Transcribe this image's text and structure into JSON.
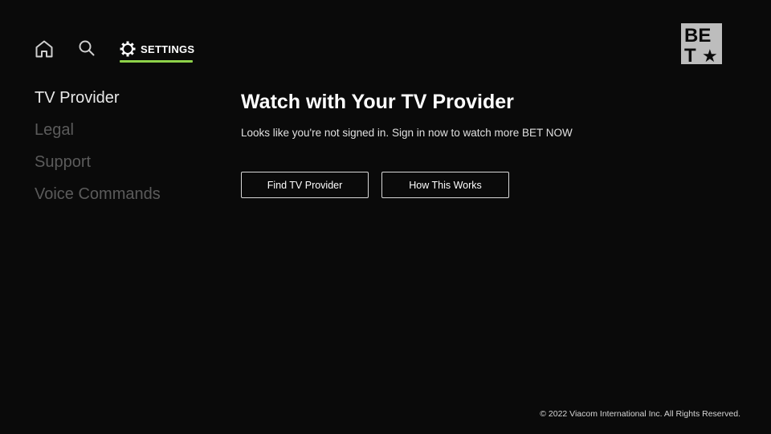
{
  "nav": {
    "home_icon": "home-icon",
    "search_icon": "search-icon",
    "settings_icon": "gear-icon",
    "settings_label": "SETTINGS",
    "active_underline_color": "#8ed24a"
  },
  "logo": {
    "text_line1": "BE",
    "text_line2": "T",
    "star": "★",
    "background_color": "#bdbdbd"
  },
  "sidebar": {
    "items": [
      {
        "label": "TV Provider",
        "active": true
      },
      {
        "label": "Legal",
        "active": false
      },
      {
        "label": "Support",
        "active": false
      },
      {
        "label": "Voice Commands",
        "active": false
      }
    ]
  },
  "main": {
    "title": "Watch with Your TV Provider",
    "subtitle": "Looks like you're not signed in. Sign in now to watch more BET NOW",
    "buttons": {
      "find_provider": "Find TV Provider",
      "how_it_works": "How This Works"
    }
  },
  "footer": {
    "copyright": "© 2022 Viacom International Inc. All Rights Reserved."
  }
}
